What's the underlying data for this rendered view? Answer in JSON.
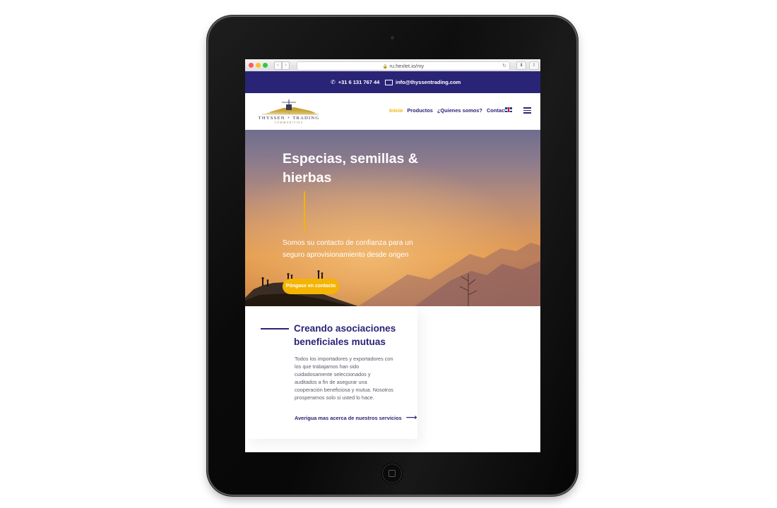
{
  "browser": {
    "url": "ru.hexlet.io/my",
    "back": "‹",
    "forward": "›",
    "reload": "↻",
    "download": "⬇",
    "share": "⇪"
  },
  "topbar": {
    "phone": "+31 6 131 767 44",
    "email": "info@thyssentrading.com",
    "background": "#2a2477"
  },
  "header": {
    "logo_brand": "THYSSEN + TRADING",
    "logo_tagline": "COMMODITIES",
    "nav": [
      "Inicio",
      "Productos",
      "¿Quienes somos?",
      "Contacto"
    ],
    "active_index": 0,
    "language_icon": "uk-flag-icon",
    "menu_icon": "hamburger-icon"
  },
  "hero": {
    "title": "Especias, semillas & hierbas",
    "subtitle": "Somos su contacto de confianza para un seguro aprovisionamiento desde origen",
    "cta": "Póngase en contacto"
  },
  "section": {
    "title": "Creando asociaciones beneficiales mutuas",
    "body": "Todos los importadores y exportadores con los que trabajamos han sido cuidadosamente seleccionados y auditados a fin de asegurar una cooperación beneficiosa y mutua. Nosotros prosperamos solo si usted lo hace.",
    "link": "Averigua mas acerca de nuestros servicios"
  },
  "colors": {
    "primary": "#2a2477",
    "accent": "#f4b400"
  }
}
